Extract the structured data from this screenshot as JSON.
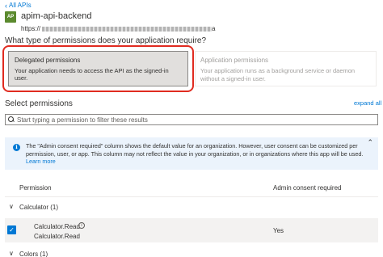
{
  "nav": {
    "back_label": "All APIs"
  },
  "app": {
    "icon_text": "AP",
    "name": "apim-api-backend",
    "uri_prefix": "https://",
    "uri_suffix": "a"
  },
  "question": "What type of permissions does your application require?",
  "permission_types": {
    "delegated": {
      "title": "Delegated permissions",
      "description": "Your application needs to access the API as the signed-in user."
    },
    "application": {
      "title": "Application permissions",
      "description": "Your application runs as a background service or daemon without a signed-in user."
    }
  },
  "select_permissions": {
    "title": "Select permissions",
    "expand_all_label": "expand all",
    "filter_placeholder": "Start typing a permission to filter these results"
  },
  "info": {
    "text": "The \"Admin consent required\" column shows the default value for an organization. However, user consent can be customized per permission, user, or app. This column may not reflect the value in your organization, or in organizations where this app will be used.",
    "learn_more_label": "Learn more",
    "icon": "info-icon"
  },
  "table": {
    "columns": [
      "Permission",
      "Admin consent required"
    ],
    "groups": [
      {
        "label": "Calculator (1)",
        "expanded": true,
        "items": [
          {
            "name": "Calculator.Read",
            "description": "Calculator.Read",
            "admin_consent": "Yes",
            "checked": true
          }
        ]
      },
      {
        "label": "Colors (1)",
        "expanded": true,
        "items": []
      }
    ]
  },
  "colors": {
    "accent": "#0078d4",
    "highlight": "#e02b20",
    "app_icon": "#5b8a2e",
    "info_bg": "#ebf3fc"
  }
}
